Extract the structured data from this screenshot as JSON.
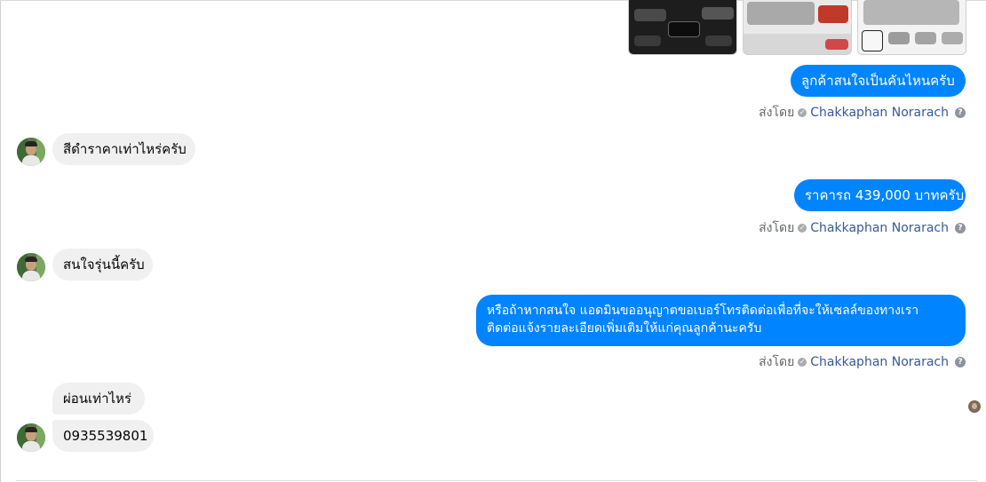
{
  "colors": {
    "outgoing": "#0084ff",
    "incoming": "#f0f0f0",
    "sender_name": "#385898",
    "meta": "#65676b"
  },
  "messages": {
    "m1": {
      "text": "ลูกค้าสนใจเป็นคันไหนครับ"
    },
    "m2": {
      "text": "สีดำราคาเท่าไหร่ครับ"
    },
    "m3": {
      "text": "ราคารถ 439,000 บาทครับ"
    },
    "m4": {
      "text": "สนใจรุ่นนี้ครับ"
    },
    "m5": {
      "line1": "หรือถ้าหากสนใจ แอดมินขออนุญาตขอเบอร์โทรติดต่อเพื่อที่จะให้เซลล์ของทางเรา",
      "line2": "ติดต่อแจ้งรายละเอียดเพิ่มเติมให้แก่คุณลูกค้านะครับ"
    },
    "m6": {
      "text": "ผ่อนเท่าไหร่"
    },
    "m7": {
      "text": "0935539801"
    }
  },
  "sent_by": {
    "prefix": "ส่งโดย",
    "name": "Chakkaphan Norarach"
  },
  "icons": [
    "verified-icon",
    "help-icon",
    "avatar-icon",
    "seen-avatar-icon"
  ]
}
